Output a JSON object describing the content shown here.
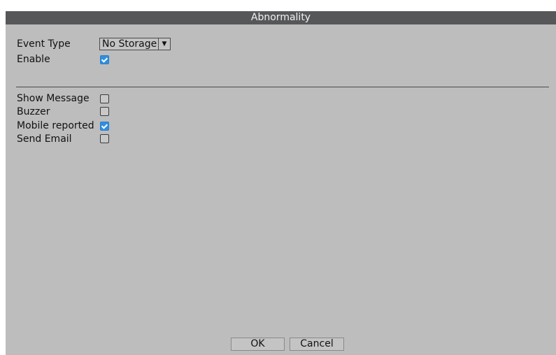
{
  "dialog": {
    "title": "Abnormality",
    "event_type": {
      "label": "Event Type",
      "value": "No Storage"
    },
    "enable": {
      "label": "Enable",
      "checked": true
    },
    "options": [
      {
        "label": "Show Message",
        "checked": false
      },
      {
        "label": "Buzzer",
        "checked": false
      },
      {
        "label": "Mobile reported",
        "checked": true
      },
      {
        "label": "Send Email",
        "checked": false
      }
    ],
    "buttons": {
      "ok": "OK",
      "cancel": "Cancel"
    }
  },
  "icons": {
    "dropdown": "chevron-down-icon",
    "check": "checkmark-icon"
  },
  "colors": {
    "title_bar": "#555759",
    "panel": "#bdbdbd",
    "checkbox_on": "#2f8fe0"
  }
}
